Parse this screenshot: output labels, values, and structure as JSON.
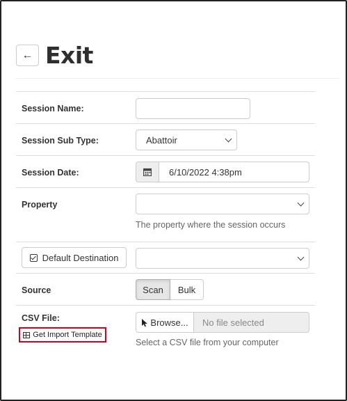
{
  "header": {
    "back_icon": "←",
    "title": "Exit"
  },
  "form": {
    "session_name": {
      "label": "Session Name:",
      "value": ""
    },
    "session_sub_type": {
      "label": "Session Sub Type:",
      "value": "Abattoir"
    },
    "session_date": {
      "label": "Session Date:",
      "icon": "calendar-icon",
      "value": "6/10/2022 4:38pm"
    },
    "property": {
      "label": "Property",
      "value": "",
      "help": "The property where the session occurs"
    },
    "destination": {
      "button_label": "Default Destination",
      "value": ""
    },
    "source": {
      "label": "Source",
      "options": [
        "Scan",
        "Bulk"
      ],
      "selected": "Scan"
    },
    "csv_file": {
      "label": "CSV File:",
      "browse_label": "Browse...",
      "file_placeholder": "No file selected",
      "help": "Select a CSV file from your computer",
      "template_link": "Get Import Template"
    }
  },
  "colors": {
    "highlight_border": "#d0021b"
  }
}
